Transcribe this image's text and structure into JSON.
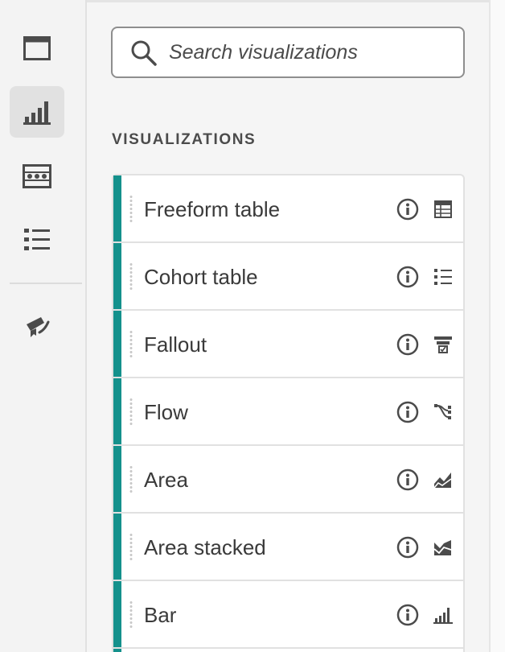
{
  "search": {
    "placeholder": "Search visualizations",
    "value": ""
  },
  "section": {
    "title": "VISUALIZATIONS"
  },
  "rail": {
    "items": [
      {
        "icon": "panel-icon",
        "active": false
      },
      {
        "icon": "bar-chart-icon",
        "active": true
      },
      {
        "icon": "components-icon",
        "active": false
      },
      {
        "icon": "list-icon",
        "active": false
      },
      {
        "icon": "brush-icon",
        "active": false
      }
    ]
  },
  "visualizations": [
    {
      "label": "Freeform table",
      "icon": "table-icon"
    },
    {
      "label": "Cohort table",
      "icon": "numbered-list-icon"
    },
    {
      "label": "Fallout",
      "icon": "funnel-icon"
    },
    {
      "label": "Flow",
      "icon": "flow-icon"
    },
    {
      "label": "Area",
      "icon": "area-chart-icon"
    },
    {
      "label": "Area stacked",
      "icon": "area-stacked-icon"
    },
    {
      "label": "Bar",
      "icon": "bar-chart-icon"
    }
  ],
  "colors": {
    "accent": "#14918c",
    "icon": "#4b4b4b",
    "text": "#3a3a3a"
  }
}
